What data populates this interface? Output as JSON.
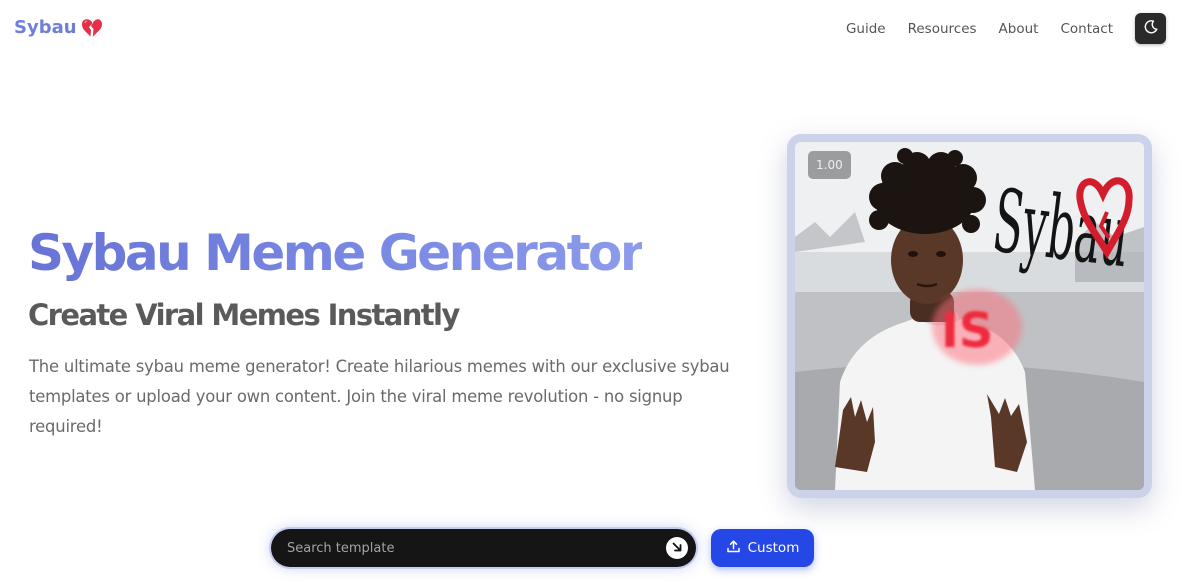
{
  "header": {
    "logo_text": "Sybau",
    "logo_icon": "broken-heart-icon",
    "nav": [
      {
        "label": "Guide"
      },
      {
        "label": "Resources"
      },
      {
        "label": "About"
      },
      {
        "label": "Contact"
      }
    ],
    "theme_toggle_icon": "moon-icon"
  },
  "hero": {
    "title": "Sybau Meme Generator",
    "subtitle": "Create Viral Memes Instantly",
    "description": "The ultimate sybau meme generator! Create hilarious memes with our exclusive sybau templates or upload your own content. Join the viral meme revolution - no signup required!"
  },
  "meme_preview": {
    "scale_badge": "1.00",
    "text_large": "Sybau",
    "text_small": "IS"
  },
  "search": {
    "placeholder": "Search template",
    "submit_icon": "arrow-down-right-icon"
  },
  "custom_button": {
    "label": "Custom",
    "icon": "upload-icon"
  },
  "colors": {
    "brand": "#6f7fd6",
    "primary_button": "#2547e6",
    "search_bg": "#151515"
  }
}
